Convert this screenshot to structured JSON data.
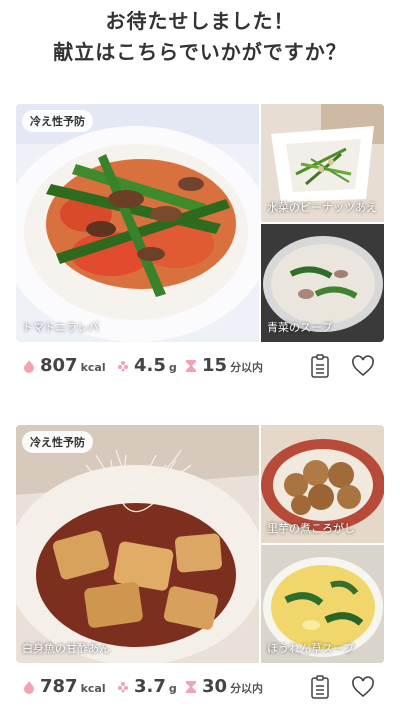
{
  "header": {
    "line1": "お待たせしました！",
    "line2": "献立はこちらでいかがですか？"
  },
  "menus": [
    {
      "badge": "冷え性予防",
      "main_dish": "トマトニラレバ",
      "side1": "水菜のピーナッツあえ",
      "side2": "青菜のスープ",
      "kcal": "807",
      "kcal_unit": "kcal",
      "salt": "4.5",
      "salt_unit": "g",
      "time": "15",
      "time_unit": "分以内"
    },
    {
      "badge": "冷え性予防",
      "main_dish": "白身魚の甘酢あん",
      "side1": "里芋の煮ころがし",
      "side2": "ほうれん草スープ",
      "kcal": "787",
      "kcal_unit": "kcal",
      "salt": "3.7",
      "salt_unit": "g",
      "time": "30",
      "time_unit": "分以内"
    }
  ],
  "colors": {
    "icon_pink": "#f2a3b3",
    "text_dark": "#444444"
  },
  "icons": [
    "flame-icon",
    "salt-icon",
    "hourglass-icon",
    "memo-icon",
    "heart-icon"
  ]
}
